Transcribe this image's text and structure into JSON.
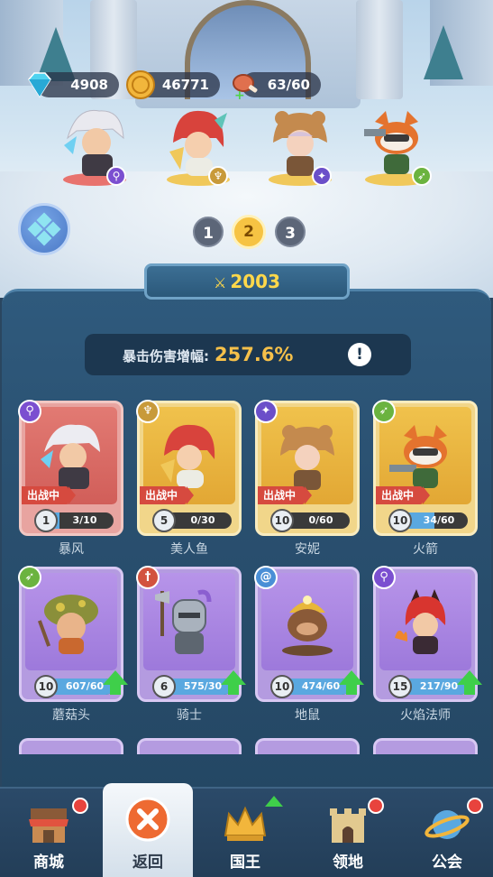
{
  "resources": {
    "gems": "4908",
    "coins": "46771",
    "stamina": "63/60"
  },
  "team_pages": [
    "1",
    "2",
    "3"
  ],
  "active_page": "2",
  "power": "2003",
  "crit": {
    "label": "暴击伤害增幅:",
    "value": "257.6%",
    "info_symbol": "!"
  },
  "heroes": [
    {
      "name": "暴风",
      "level": "1",
      "progress": "3/10",
      "progress_fraction": 0.3,
      "deployed": true,
      "tag": "出战中",
      "rarity": "red",
      "class_icon": "staff-icon",
      "class_color": "#7b4fd0",
      "upgradable": false
    },
    {
      "name": "美人鱼",
      "level": "5",
      "progress": "0/30",
      "progress_fraction": 0.0,
      "deployed": true,
      "tag": "出战中",
      "rarity": "gold",
      "class_icon": "horn-icon",
      "class_color": "#c89a3a",
      "upgradable": false
    },
    {
      "name": "安妮",
      "level": "10",
      "progress": "0/60",
      "progress_fraction": 0.0,
      "deployed": true,
      "tag": "出战中",
      "rarity": "gold",
      "class_icon": "paw-icon",
      "class_color": "#6b4fc9",
      "upgradable": false
    },
    {
      "name": "火箭",
      "level": "10",
      "progress": "34/60",
      "progress_fraction": 0.57,
      "deployed": true,
      "tag": "出战中",
      "rarity": "gold",
      "class_icon": "bow-icon",
      "class_color": "#6bb33f",
      "upgradable": false
    },
    {
      "name": "蘑菇头",
      "level": "10",
      "progress": "607/60",
      "progress_fraction": 1.0,
      "deployed": false,
      "rarity": "purple",
      "class_icon": "bow-icon",
      "class_color": "#6bb33f",
      "upgradable": true
    },
    {
      "name": "骑士",
      "level": "6",
      "progress": "575/30",
      "progress_fraction": 1.0,
      "deployed": false,
      "rarity": "purple",
      "class_icon": "sword-icon",
      "class_color": "#d2533f",
      "upgradable": true
    },
    {
      "name": "地鼠",
      "level": "10",
      "progress": "474/60",
      "progress_fraction": 1.0,
      "deployed": false,
      "rarity": "purple",
      "class_icon": "swirl-icon",
      "class_color": "#4a8fd6",
      "upgradable": true
    },
    {
      "name": "火焰法师",
      "level": "15",
      "progress": "217/90",
      "progress_fraction": 1.0,
      "deployed": false,
      "rarity": "purple",
      "class_icon": "staff-icon",
      "class_color": "#7b4fd0",
      "upgradable": true
    }
  ],
  "nav": [
    {
      "label": "商城",
      "icon": "shop-icon",
      "alert": true
    },
    {
      "label": "返回",
      "icon": "close-icon",
      "active": true
    },
    {
      "label": "国王",
      "icon": "crown-icon",
      "upgrade": true
    },
    {
      "label": "领地",
      "icon": "castle-icon",
      "alert": true
    },
    {
      "label": "公会",
      "icon": "planet-icon",
      "alert": true
    }
  ]
}
